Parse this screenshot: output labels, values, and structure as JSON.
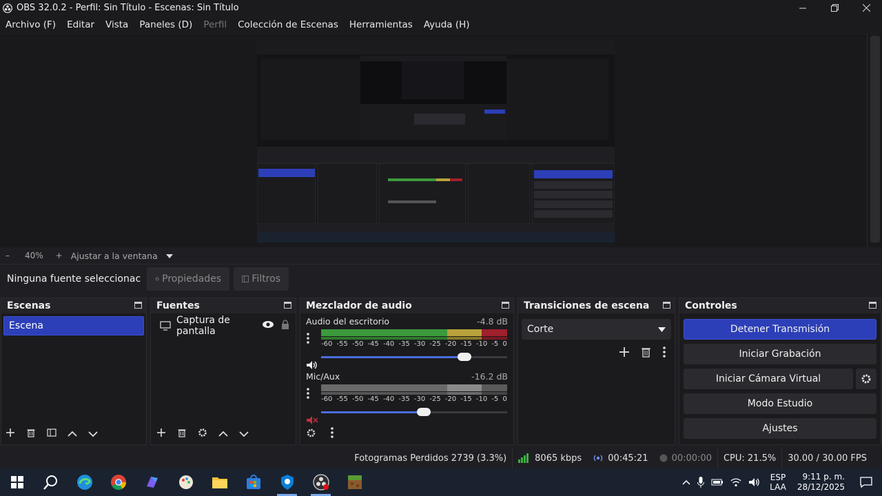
{
  "window": {
    "title": "OBS 32.0.2 - Perfil: Sin Título - Escenas: Sin Título"
  },
  "menu": [
    {
      "label": "Archivo (F)",
      "enabled": true
    },
    {
      "label": "Editar",
      "enabled": true
    },
    {
      "label": "Vista",
      "enabled": true
    },
    {
      "label": "Paneles (D)",
      "enabled": true
    },
    {
      "label": "Perfil",
      "enabled": false
    },
    {
      "label": "Colección de Escenas",
      "enabled": true
    },
    {
      "label": "Herramientas",
      "enabled": true
    },
    {
      "label": "Ayuda (H)",
      "enabled": true
    }
  ],
  "zoom": {
    "minus": "–",
    "value": "40%",
    "plus": "+",
    "fit_label": "Ajustar a la ventana"
  },
  "context": {
    "selection": "Ninguna fuente seleccionac",
    "properties_label": "Propiedades",
    "filters_label": "Filtros"
  },
  "scenes": {
    "title": "Escenas",
    "items": [
      "Escena"
    ]
  },
  "sources": {
    "title": "Fuentes",
    "items": [
      "Captura de pantalla"
    ]
  },
  "mixer": {
    "title": "Mezclador de audio",
    "channels": [
      {
        "name": "Audio del escritorio",
        "db": "-4.8 dB",
        "volume": 0.77,
        "muted": false
      },
      {
        "name": "Mic/Aux",
        "db": "-16.2 dB",
        "volume": 0.55,
        "muted": true
      }
    ],
    "scale": [
      "-60",
      "-55",
      "-50",
      "-45",
      "-40",
      "-35",
      "-30",
      "-25",
      "-20",
      "-15",
      "-10",
      "-5",
      "0"
    ]
  },
  "transitions": {
    "title": "Transiciones de escena",
    "selected": "Corte"
  },
  "controls": {
    "title": "Controles",
    "stop_stream": "Detener Transmisión",
    "start_recording": "Iniciar Grabación",
    "start_virtual_cam": "Iniciar Cámara Virtual",
    "studio_mode": "Modo Estudio",
    "settings": "Ajustes"
  },
  "status": {
    "dropped_frames": "Fotogramas Perdidos 2739 (3.3%)",
    "bitrate": "8065 kbps",
    "stream_time": "00:45:21",
    "rec_time": "00:00:00",
    "cpu": "CPU: 21.5%",
    "fps": "30.00 / 30.00 FPS"
  },
  "taskbar": {
    "lang": "ESP",
    "layout": "LAA",
    "time": "9:11 p. m.",
    "date": "28/12/2025"
  },
  "colors": {
    "accent": "#2c3fb8",
    "meter_green": "#3c9a3c",
    "meter_yellow": "#b8a23a",
    "meter_red": "#a0202c"
  }
}
